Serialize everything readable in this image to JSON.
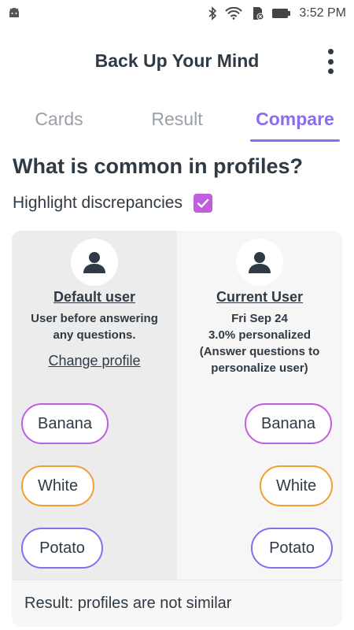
{
  "status_bar": {
    "time": "3:52 PM",
    "icons": [
      "android-icon",
      "bluetooth-icon",
      "wifi-icon",
      "sd-card-icon",
      "battery-icon"
    ]
  },
  "app_bar": {
    "title": "Back Up Your Mind",
    "menu_icon": "more-vert-icon"
  },
  "tabs": [
    {
      "label": "Cards",
      "active": false
    },
    {
      "label": "Result",
      "active": false
    },
    {
      "label": "Compare",
      "active": true
    }
  ],
  "compare": {
    "title": "What is common in profiles?",
    "highlight_label": "Highlight discrepancies",
    "highlight_checked": true,
    "left_user": {
      "name": "Default user",
      "description_lines": [
        "User before answering",
        "any questions."
      ],
      "change_link": "Change profile"
    },
    "right_user": {
      "name": "Current User",
      "description_lines": [
        "Fri Sep 24",
        "3.0% personalized",
        "(Answer questions to",
        "personalize user)"
      ]
    },
    "left_chips": [
      "Banana",
      "White",
      "Potato"
    ],
    "right_chips": [
      "Banana",
      "White",
      "Potato"
    ],
    "result_text": "Result: profiles are not similar"
  },
  "colors": {
    "accent": "#8a6cf0",
    "checkbox": "#c15ee0",
    "chip_banana": "#c15ee0",
    "chip_white": "#f0a030",
    "chip_potato": "#8a6cf0",
    "text": "#2f3a44",
    "inactive_tab": "#9aa0a6"
  }
}
